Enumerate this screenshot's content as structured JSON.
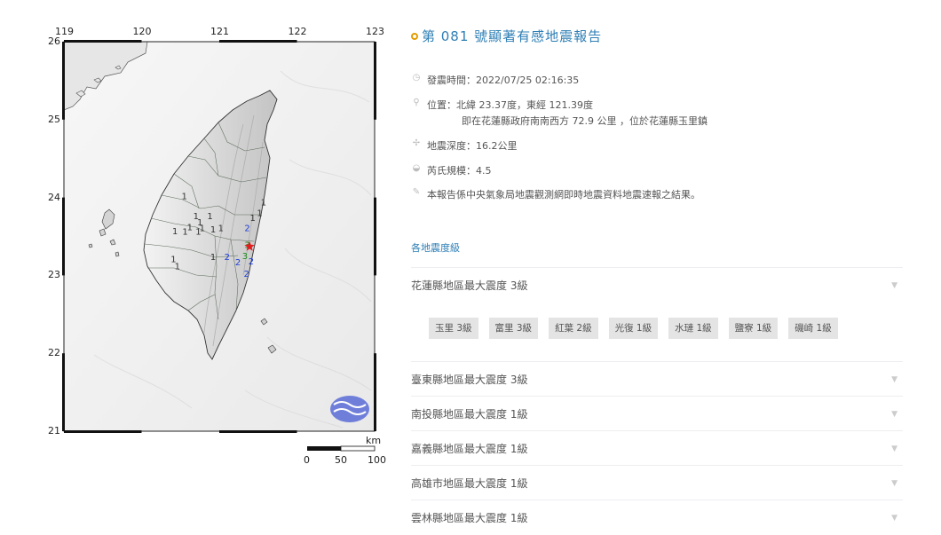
{
  "map": {
    "lon_ticks": [
      "119",
      "120",
      "121",
      "122",
      "123"
    ],
    "lat_ticks": [
      "26",
      "25",
      "24",
      "23",
      "22",
      "21"
    ],
    "scale_unit": "km",
    "scale_labels": [
      "0",
      "50",
      "100"
    ],
    "epicenter": {
      "lon": 121.39,
      "lat": 23.37
    },
    "intensity_marks": [
      {
        "value": "1",
        "lon": 120.55,
        "lat": 23.98,
        "color": "#333333"
      },
      {
        "value": "1",
        "lon": 120.7,
        "lat": 23.72,
        "color": "#333333"
      },
      {
        "value": "1",
        "lon": 120.75,
        "lat": 23.64,
        "color": "#333333"
      },
      {
        "value": "1",
        "lon": 120.88,
        "lat": 23.72,
        "color": "#333333"
      },
      {
        "value": "1",
        "lon": 120.92,
        "lat": 23.55,
        "color": "#333333"
      },
      {
        "value": "1",
        "lon": 120.43,
        "lat": 23.53,
        "color": "#333333"
      },
      {
        "value": "1",
        "lon": 120.56,
        "lat": 23.52,
        "color": "#333333"
      },
      {
        "value": "1",
        "lon": 120.62,
        "lat": 23.58,
        "color": "#333333"
      },
      {
        "value": "1",
        "lon": 120.73,
        "lat": 23.52,
        "color": "#333333"
      },
      {
        "value": "1",
        "lon": 121.02,
        "lat": 23.57,
        "color": "#333333"
      },
      {
        "value": "1",
        "lon": 120.78,
        "lat": 23.57,
        "color": "#333333"
      },
      {
        "value": "1",
        "lon": 120.41,
        "lat": 23.17,
        "color": "#333333"
      },
      {
        "value": "1",
        "lon": 120.46,
        "lat": 23.08,
        "color": "#333333"
      },
      {
        "value": "1",
        "lon": 120.92,
        "lat": 23.2,
        "color": "#333333"
      },
      {
        "value": "1",
        "lon": 121.43,
        "lat": 23.7,
        "color": "#333333"
      },
      {
        "value": "1",
        "lon": 121.57,
        "lat": 23.9,
        "color": "#333333"
      },
      {
        "value": "1",
        "lon": 121.52,
        "lat": 23.76,
        "color": "#333333"
      },
      {
        "value": "2",
        "lon": 121.36,
        "lat": 23.57,
        "color": "#1f3fd6"
      },
      {
        "value": "2",
        "lon": 121.1,
        "lat": 23.2,
        "color": "#1f3fd6"
      },
      {
        "value": "2",
        "lon": 121.35,
        "lat": 22.98,
        "color": "#1f3fd6"
      },
      {
        "value": "2",
        "lon": 121.41,
        "lat": 23.14,
        "color": "#1f3fd6"
      },
      {
        "value": "2",
        "lon": 121.24,
        "lat": 23.13,
        "color": "#1f3fd6"
      },
      {
        "value": "3",
        "lon": 121.36,
        "lat": 23.35,
        "color": "#1d8a1d"
      },
      {
        "value": "3",
        "lon": 121.33,
        "lat": 23.21,
        "color": "#1d8a1d"
      }
    ]
  },
  "report": {
    "title": "第 081 號顯著有感地震報告",
    "time_label": "發震時間：2022/07/25 02:16:35",
    "location_label": "位置：北緯 23.37度，東經 121.39度",
    "location_detail": "即在花蓮縣政府南南西方 72.9 公里 ，位於花蓮縣玉里鎮",
    "depth_label": "地震深度：16.2公里",
    "magnitude_label": "芮氏規模：4.5",
    "note": "本報告係中央氣象局地震觀測網即時地震資料地震速報之結果。",
    "intensity_section_title": "各地震度級",
    "counties": [
      "花蓮縣地區最大震度 3級",
      "臺東縣地區最大震度 3級",
      "南投縣地區最大震度 1級",
      "嘉義縣地區最大震度 1級",
      "高雄市地區最大震度 1級",
      "雲林縣地區最大震度 1級"
    ],
    "stations": [
      "玉里 3級",
      "富里 3級",
      "紅葉 2級",
      "光復 1級",
      "水璉 1級",
      "鹽寮 1級",
      "磯崎 1級"
    ]
  },
  "colors": {
    "accent": "#2f7fb5",
    "title_ring": "#e39b00",
    "epicenter": "#e02020"
  }
}
